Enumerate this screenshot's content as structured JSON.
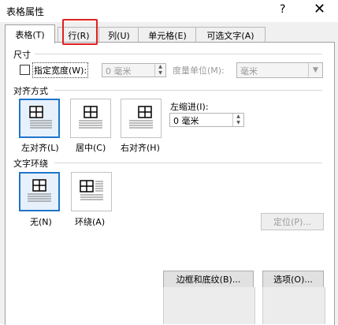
{
  "window": {
    "title": "表格属性",
    "help": "?",
    "close": "✕"
  },
  "tabs": [
    {
      "label": "表格(T)"
    },
    {
      "label": "行(R)"
    },
    {
      "label": "列(U)"
    },
    {
      "label": "单元格(E)"
    },
    {
      "label": "可选文字(A)"
    }
  ],
  "size": {
    "section_label": "尺寸",
    "specify_width_label": "指定宽度(W):",
    "width_value": "0 毫米",
    "unit_label": "度量单位(M):",
    "unit_value": "毫米"
  },
  "alignment": {
    "section_label": "对齐方式",
    "options": [
      {
        "label": "左对齐(L)"
      },
      {
        "label": "居中(C)"
      },
      {
        "label": "右对齐(H)"
      }
    ],
    "indent_label": "左缩进(I):",
    "indent_value": "0 毫米"
  },
  "wrapping": {
    "section_label": "文字环绕",
    "options": [
      {
        "label": "无(N)"
      },
      {
        "label": "环绕(A)"
      }
    ],
    "position_button": "定位(P)..."
  },
  "footer": {
    "borders_button": "边框和底纹(B)...",
    "options_button": "选项(O)..."
  }
}
